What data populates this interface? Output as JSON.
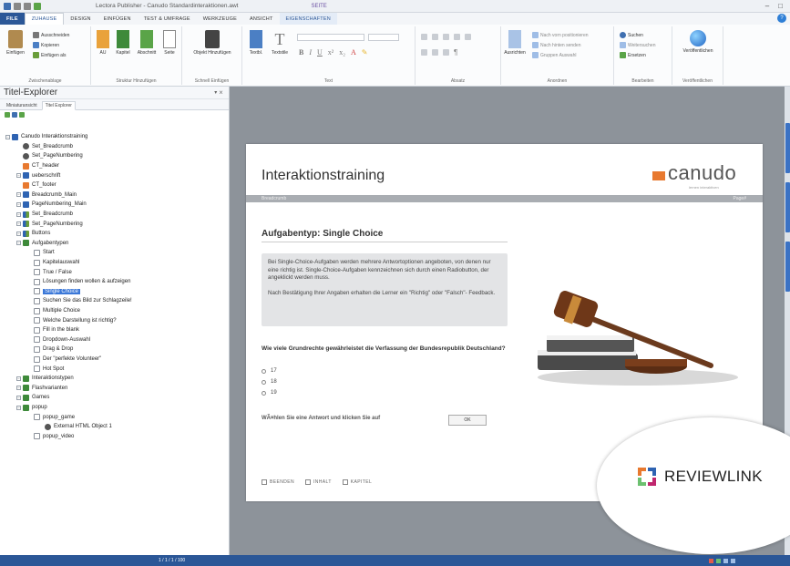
{
  "titlebar": {
    "title": "Lectora Publisher - Canudo Standardinteraktionen.awt",
    "context_tab_group": "SEITE"
  },
  "tabs": [
    {
      "label": "FILE",
      "type": "file"
    },
    {
      "label": "ZUHAUSE",
      "type": "active"
    },
    {
      "label": "DESIGN",
      "type": "normal"
    },
    {
      "label": "EINFÜGEN",
      "type": "normal"
    },
    {
      "label": "TEST & UMFRAGE",
      "type": "normal"
    },
    {
      "label": "WERKZEUGE",
      "type": "normal"
    },
    {
      "label": "ANSICHT",
      "type": "normal"
    },
    {
      "label": "EIGENSCHAFTEN",
      "type": "ctx"
    }
  ],
  "ribbon": {
    "clipboard": {
      "label": "Zwischenablage",
      "paste": "Einfügen",
      "cut": "Ausschneiden",
      "copy": "Kopieren",
      "paste_all": "Einfügen als"
    },
    "structure": {
      "label": "Struktur Hinzufügen",
      "all": "AU",
      "chapter": "Kapitel",
      "section": "Abschnitt",
      "page": "Seite"
    },
    "quick_insert": {
      "label": "Schnell Einfügen",
      "add_object": "Objekt Hinzufügen"
    },
    "text": {
      "label": "Text",
      "textbox": "Textbl.",
      "text_style": "Textstile",
      "bold": "B",
      "italic": "I",
      "underline": "U"
    },
    "paragraph": {
      "label": "Absatz"
    },
    "arrange": {
      "label": "Anordnen",
      "align": "Ausrichten",
      "to_front": "Nach vorn positionieren",
      "to_back": "Nach hinten senden",
      "group": "Gruppen Auswahl"
    },
    "edit": {
      "label": "Bearbeiten",
      "search": "Suchen",
      "replace": "Weitersuchen",
      "replace2": "Ersetzen"
    },
    "publish": {
      "label": "Veröffentlichen",
      "publish": "Veröffentlichen"
    }
  },
  "explorer": {
    "title": "Titel-Explorer",
    "subtabs": [
      "Miniaturansicht",
      "Titel Explorer"
    ],
    "tree": [
      {
        "label": "Canudo Interaktionstraining",
        "icon": "blue",
        "depth": 0
      },
      {
        "label": "Set_Breadcrumb",
        "icon": "gear",
        "depth": 1
      },
      {
        "label": "Set_PageNumbering",
        "icon": "gear",
        "depth": 1
      },
      {
        "label": "CT_header",
        "icon": "orange",
        "depth": 1
      },
      {
        "label": "ueberschrift",
        "icon": "blue",
        "depth": 1
      },
      {
        "label": "CT_footer",
        "icon": "orange",
        "depth": 1
      },
      {
        "label": "Breadcrumb_Main",
        "icon": "blue",
        "depth": 1
      },
      {
        "label": "PageNumbering_Main",
        "icon": "blue",
        "depth": 1
      },
      {
        "label": "Set_Breadcrumb",
        "icon": "mix",
        "depth": 1
      },
      {
        "label": "Set_PageNumbering",
        "icon": "mix",
        "depth": 1
      },
      {
        "label": "Buttons",
        "icon": "mix",
        "depth": 1
      },
      {
        "label": "Aufgabentypen",
        "icon": "folder",
        "depth": 1
      },
      {
        "label": "Start",
        "icon": "page",
        "depth": 2
      },
      {
        "label": "Kapitelauswahl",
        "icon": "page",
        "depth": 2
      },
      {
        "label": "True / False",
        "icon": "page",
        "depth": 2
      },
      {
        "label": "Lösungen finden wollen & aufzeigen",
        "icon": "page",
        "depth": 2
      },
      {
        "label": "Single Choice",
        "icon": "page",
        "depth": 2,
        "selected": true
      },
      {
        "label": "Suchen Sie das Bild zur Schlagzeile!",
        "icon": "page",
        "depth": 2
      },
      {
        "label": "Multiple Choice",
        "icon": "page",
        "depth": 2
      },
      {
        "label": "Welche Darstellung ist richtig?",
        "icon": "page",
        "depth": 2
      },
      {
        "label": "Fill in the blank",
        "icon": "page",
        "depth": 2
      },
      {
        "label": "Dropdown-Auswahl",
        "icon": "page",
        "depth": 2
      },
      {
        "label": "Drag & Drop",
        "icon": "page",
        "depth": 2
      },
      {
        "label": "Der \"perfekte Volunteer\"",
        "icon": "page",
        "depth": 2
      },
      {
        "label": "Hot Spot",
        "icon": "page",
        "depth": 2
      },
      {
        "label": "Interaktionstypen",
        "icon": "folder",
        "depth": 1
      },
      {
        "label": "Flashvarianten",
        "icon": "folder",
        "depth": 1
      },
      {
        "label": "Games",
        "icon": "folder",
        "depth": 1
      },
      {
        "label": "popup",
        "icon": "folder",
        "depth": 1
      },
      {
        "label": "popup_game",
        "icon": "page",
        "depth": 2
      },
      {
        "label": "External HTML Object 1",
        "icon": "gear",
        "depth": 3
      },
      {
        "label": "popup_video",
        "icon": "page",
        "depth": 2
      }
    ]
  },
  "page": {
    "title": "Interaktionstraining",
    "brand": "canudo",
    "tagline": "lernen interaktiven",
    "breadcrumb": "Breadcrumb",
    "page_number": "Page#",
    "heading": "Aufgabentyp: Single Choice",
    "info_p1": "Bei Single-Choice-Aufgaben werden mehrere Antwortoptionen angeboten, von denen nur eine richtig ist. Single-Choice-Aufgaben kennzeichnen sich durch einen Radiobutton, der angeklickt werden muss.",
    "info_p2": "Nach Bestätigung Ihrer Angaben erhalten die Lerner ein \"Richtig\" oder \"Falsch\"- Feedback.",
    "question": "Wie viele Grundrechte gewährleistet die Verfassung der Bundesrepublik Deutschland?",
    "options": [
      "17",
      "18",
      "19"
    ],
    "hint": "WÃ¤hlen Sie eine Antwort und klicken Sie auf",
    "ok": "OK",
    "nav": [
      {
        "label": "BEENDEN"
      },
      {
        "label": "INHALT"
      },
      {
        "label": "KAPITEL"
      }
    ]
  },
  "badge": {
    "text": "REVIEWLINK"
  },
  "statusbar": {
    "text": "1 / 1 / 1 / 100"
  },
  "colors": {
    "accent": "#2b5797",
    "brand_orange": "#e8792f",
    "selection": "#3b78d8",
    "workspace": "#8d939a"
  }
}
